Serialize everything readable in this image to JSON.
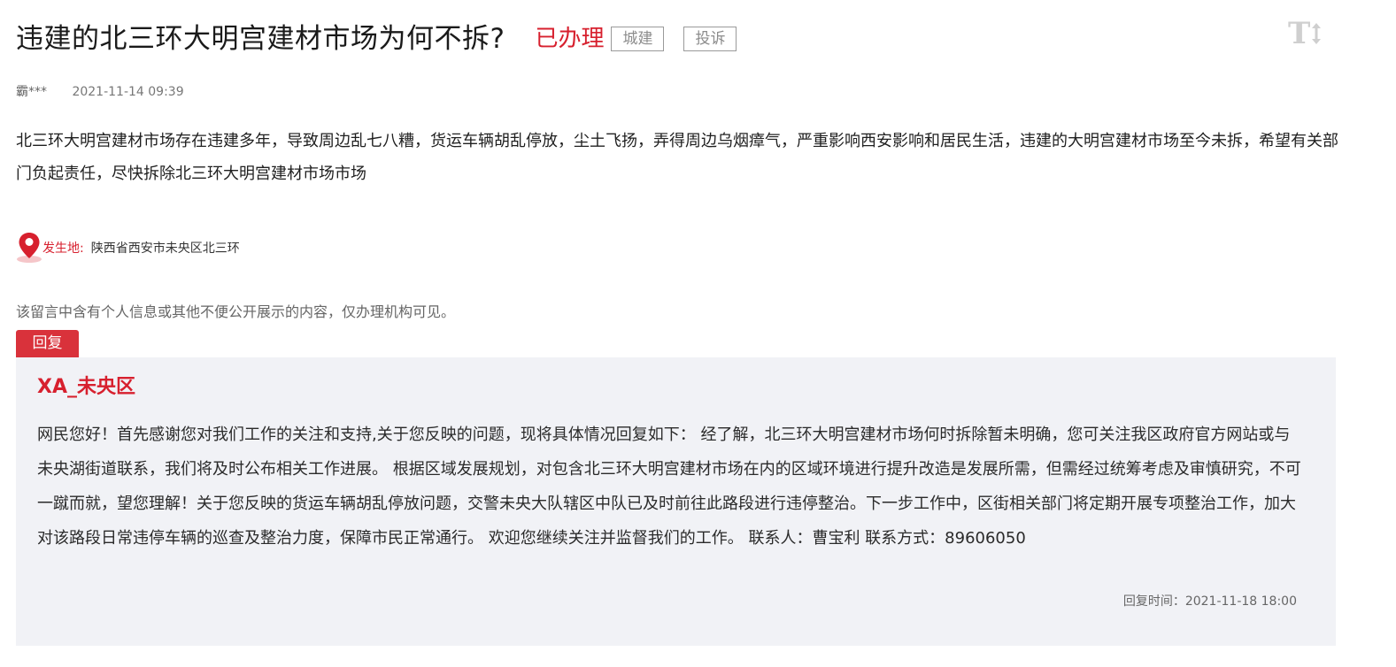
{
  "header": {
    "title": "违建的北三环大明宫建材市场为何不拆?",
    "status": "已办理",
    "tags": [
      "城建",
      "投诉"
    ]
  },
  "meta": {
    "author": "霸***",
    "date": "2021-11-14 09:39"
  },
  "content": {
    "text": "北三环大明宫建材市场存在违建多年，导致周边乱七八糟，货运车辆胡乱停放，尘土飞扬，弄得周边乌烟瘴气，严重影响西安影响和居民生活，违建的大明宫建材市场至今未拆，希望有关部门负起责任，尽快拆除北三环大明宫建材市场市场"
  },
  "location": {
    "label": "发生地:",
    "value": "陕西省西安市未央区北三环"
  },
  "privacy_notice": "该留言中含有个人信息或其他不便公开展示的内容，仅办理机构可见。",
  "reply": {
    "tab_label": "回复",
    "org": "XA_未央区",
    "text": "网民您好！首先感谢您对我们工作的关注和支持,关于您反映的问题，现将具体情况回复如下： 经了解，北三环大明宫建材市场何时拆除暂未明确，您可关注我区政府官方网站或与未央湖街道联系，我们将及时公布相关工作进展。 根据区域发展规划，对包含北三环大明宫建材市场在内的区域环境进行提升改造是发展所需，但需经过统筹考虑及审慎研究，不可一蹴而就，望您理解！关于您反映的货运车辆胡乱停放问题，交警未央大队辖区中队已及时前往此路段进行违停整治。下一步工作中，区街相关部门将定期开展专项整治工作，加大对该路段日常违停车辆的巡查及整治力度，保障市民正常通行。 欢迎您继续关注并监督我们的工作。 联系人：曹宝利 联系方式：89606050",
    "time": "回复时间：2021-11-18 18:00"
  },
  "font_toggle_icon": "font-size-toggle-icon",
  "colors": {
    "accent": "#d7202e",
    "reply_bg": "#f1f2f6",
    "tab_bg": "#d9323b"
  }
}
